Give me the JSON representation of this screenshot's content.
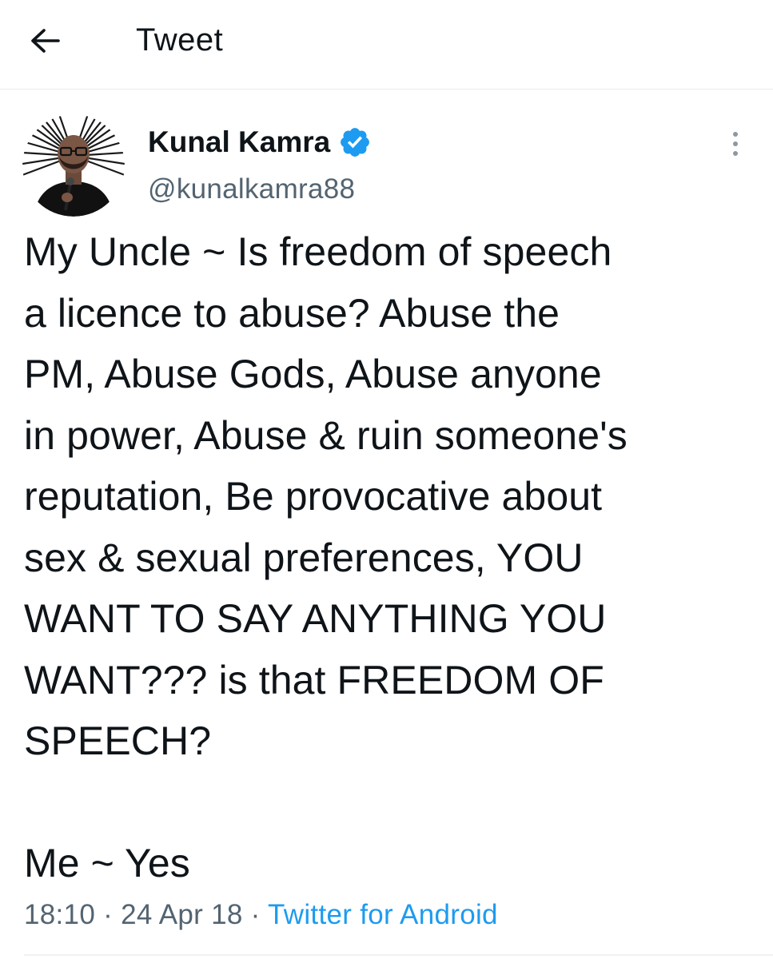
{
  "header": {
    "title": "Tweet",
    "back_icon": "arrow-left-icon"
  },
  "tweet": {
    "author": {
      "display_name": "Kunal Kamra",
      "handle": "@kunalkamra88",
      "verified": true,
      "verified_icon": "verified-badge-icon",
      "avatar_icon": "avatar-photo"
    },
    "more_icon": "more-vertical-icon",
    "text": "My Uncle ~ Is freedom of speech\na licence to abuse? Abuse the\nPM, Abuse Gods, Abuse anyone\nin power, Abuse & ruin someone's\nreputation, Be provocative about\nsex & sexual preferences, YOU\nWANT TO SAY ANYTHING YOU\nWANT??? is that FREEDOM OF\nSPEECH?\n\nMe ~ Yes",
    "time": "18:10",
    "separator_1": " · ",
    "date": "24 Apr 18",
    "separator_2": " · ",
    "source": "Twitter for Android"
  },
  "colors": {
    "text": "#0f1419",
    "secondary": "#536471",
    "accent": "#1d9bf0",
    "divider": "#e6ecf0"
  }
}
